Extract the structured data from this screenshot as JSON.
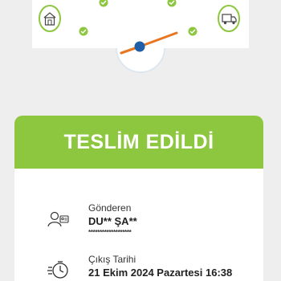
{
  "status": {
    "label": "TESLİM EDİLDİ",
    "color": "#8dc63f",
    "progress": 1.0
  },
  "gauge": {
    "start_icon": "house-package-icon",
    "end_icon": "delivery-truck-icon",
    "check_icon": "checkmark-icon",
    "needle_color": "#e87722",
    "hub_color": "#1f5fa8"
  },
  "sender": {
    "icon": "person-card-icon",
    "label": "Gönderen",
    "name": "DU** ŞA**",
    "masked": "*******************"
  },
  "exit_date": {
    "icon": "fast-clock-icon",
    "label": "Çıkış Tarihi",
    "value": "21 Ekim 2024 Pazartesi 16:38"
  }
}
